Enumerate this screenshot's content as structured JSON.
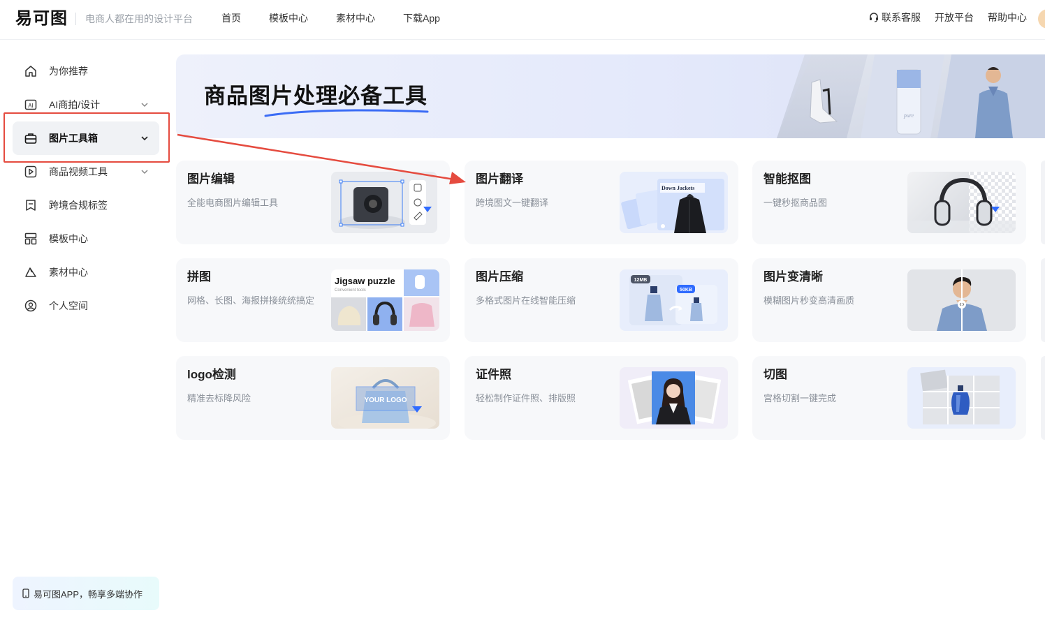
{
  "header": {
    "logo": "易可图",
    "slogan": "电商人都在用的设计平台",
    "nav": [
      "首页",
      "模板中心",
      "素材中心",
      "下载App"
    ],
    "right_links": {
      "service": "联系客服",
      "open_platform": "开放平台",
      "help": "帮助中心"
    }
  },
  "sidebar": {
    "items": [
      {
        "label": "为你推荐",
        "icon": "home-icon"
      },
      {
        "label": "AI商拍/设计",
        "icon": "ai-icon",
        "expandable": true
      },
      {
        "label": "图片工具箱",
        "icon": "toolbox-icon",
        "expandable": true,
        "active": true
      },
      {
        "label": "商品视频工具",
        "icon": "video-icon",
        "expandable": true
      },
      {
        "label": "跨境合规标签",
        "icon": "label-icon"
      },
      {
        "label": "模板中心",
        "icon": "template-icon"
      },
      {
        "label": "素材中心",
        "icon": "material-icon"
      },
      {
        "label": "个人空间",
        "icon": "user-icon"
      }
    ],
    "app_promo": "易可图APP，畅享多端协作"
  },
  "banner": {
    "title": "商品图片处理必备工具"
  },
  "tools": [
    {
      "title": "图片编辑",
      "desc": "全能电商图片编辑工具",
      "thumb": "speaker-edit"
    },
    {
      "title": "图片翻译",
      "desc": "跨境图文一键翻译",
      "thumb": "translate",
      "thumb_text": "Down Jackets"
    },
    {
      "title": "智能抠图",
      "desc": "一键秒抠商品图",
      "thumb": "headphones"
    },
    {
      "title": "拼图",
      "desc": "网格、长图、海报拼接统统搞定",
      "thumb": "jigsaw",
      "thumb_text": "Jigsaw puzzle",
      "thumb_sub": "Convenient tools"
    },
    {
      "title": "图片压缩",
      "desc": "多格式图片在线智能压缩",
      "thumb": "compress",
      "thumb_text": "12MB",
      "thumb_sub": "50KB"
    },
    {
      "title": "图片变清晰",
      "desc": "模糊图片秒变高清画质",
      "thumb": "portrait"
    },
    {
      "title": "logo检测",
      "desc": "精准去标降风险",
      "thumb": "bag",
      "thumb_text": "YOUR LOGO"
    },
    {
      "title": "证件照",
      "desc": "轻松制作证件照、排版照",
      "thumb": "id-photo"
    },
    {
      "title": "切图",
      "desc": "宫格切割一键完成",
      "thumb": "slice"
    }
  ],
  "colors": {
    "accent": "#2f6bff",
    "annotation": "#e54b3f"
  }
}
